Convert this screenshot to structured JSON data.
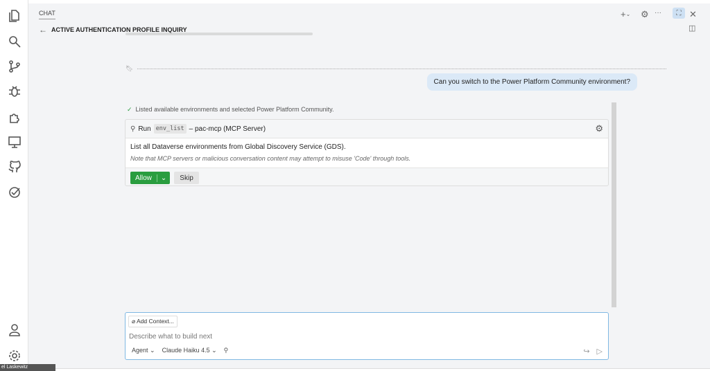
{
  "panel": {
    "tab": "CHAT",
    "title": "ACTIVE AUTHENTICATION PROFILE INQUIRY"
  },
  "toolbar": {
    "new": "+",
    "more": "···"
  },
  "user_message": "Can you switch to the Power Platform Community environment?",
  "status": "Listed available environments and selected Power Platform Community.",
  "tool_card": {
    "run": "Run",
    "tool": "env_list",
    "server": "– pac-mcp (MCP Server)",
    "description": "List all Dataverse environments from Global Discovery Service (GDS).",
    "note": "Note that MCP servers or malicious conversation content may attempt to misuse 'Code' through tools.",
    "allow": "Allow",
    "skip": "Skip"
  },
  "input": {
    "add_context": "Add Context...",
    "placeholder": "Describe what to build next",
    "mode": "Agent",
    "model": "Claude Haiku 4.5"
  },
  "user_tag": "el Laskewitz"
}
